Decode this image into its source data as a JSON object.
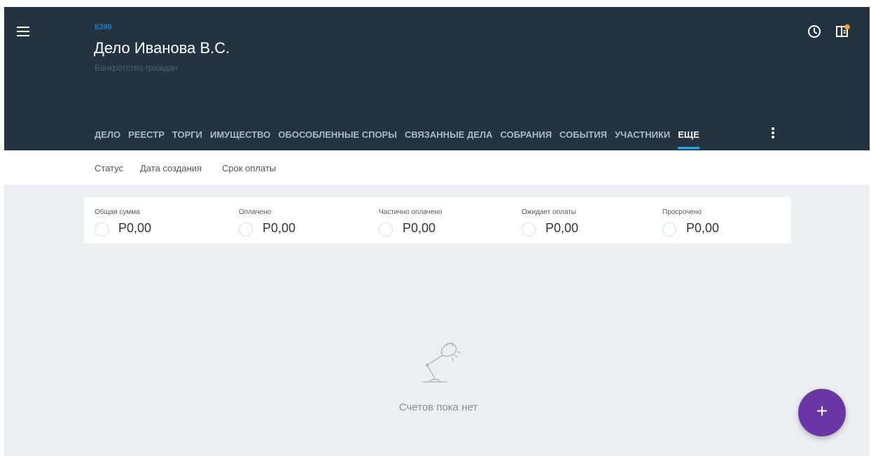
{
  "case": {
    "id": "8399",
    "title": "Дело Иванова В.С.",
    "subtitle": "Банкротство граждан"
  },
  "header_icons": [
    "menu-icon",
    "clock-icon",
    "panel-notification-icon"
  ],
  "tabs": [
    {
      "label": "ДЕЛО"
    },
    {
      "label": "РЕЕСТР"
    },
    {
      "label": "ТОРГИ"
    },
    {
      "label": "ИМУЩЕСТВО"
    },
    {
      "label": "ОБОСОБЛЕННЫЕ СПОРЫ"
    },
    {
      "label": "СВЯЗАННЫЕ ДЕЛА"
    },
    {
      "label": "СОБРАНИЯ"
    },
    {
      "label": "СОБЫТИЯ"
    },
    {
      "label": "УЧАСТНИКИ"
    },
    {
      "label": "ЕЩЕ",
      "active": true
    }
  ],
  "filters": [
    {
      "label": "Статус"
    },
    {
      "label": "Дата создания"
    },
    {
      "label": "Срок оплаты"
    }
  ],
  "summary": [
    {
      "label": "Общая сумма",
      "value": "Р0,00"
    },
    {
      "label": "Оплачено",
      "value": "Р0,00"
    },
    {
      "label": "Частично оплачено",
      "value": "Р0,00"
    },
    {
      "label": "Ожидает оплаты",
      "value": "Р0,00"
    },
    {
      "label": "Просрочено",
      "value": "Р0,00"
    }
  ],
  "empty_state": {
    "icon": "desk-lamp-icon",
    "text": "Счетов пока нет"
  },
  "fab": {
    "icon": "plus-icon",
    "label": "+"
  },
  "colors": {
    "header_bg": "#243342",
    "accent_blue": "#2196f3",
    "tab_indicator": "#29a8e0",
    "fab_purple": "#6a35a5",
    "notification_dot": "#f5a623",
    "page_bg": "#eceff1"
  }
}
